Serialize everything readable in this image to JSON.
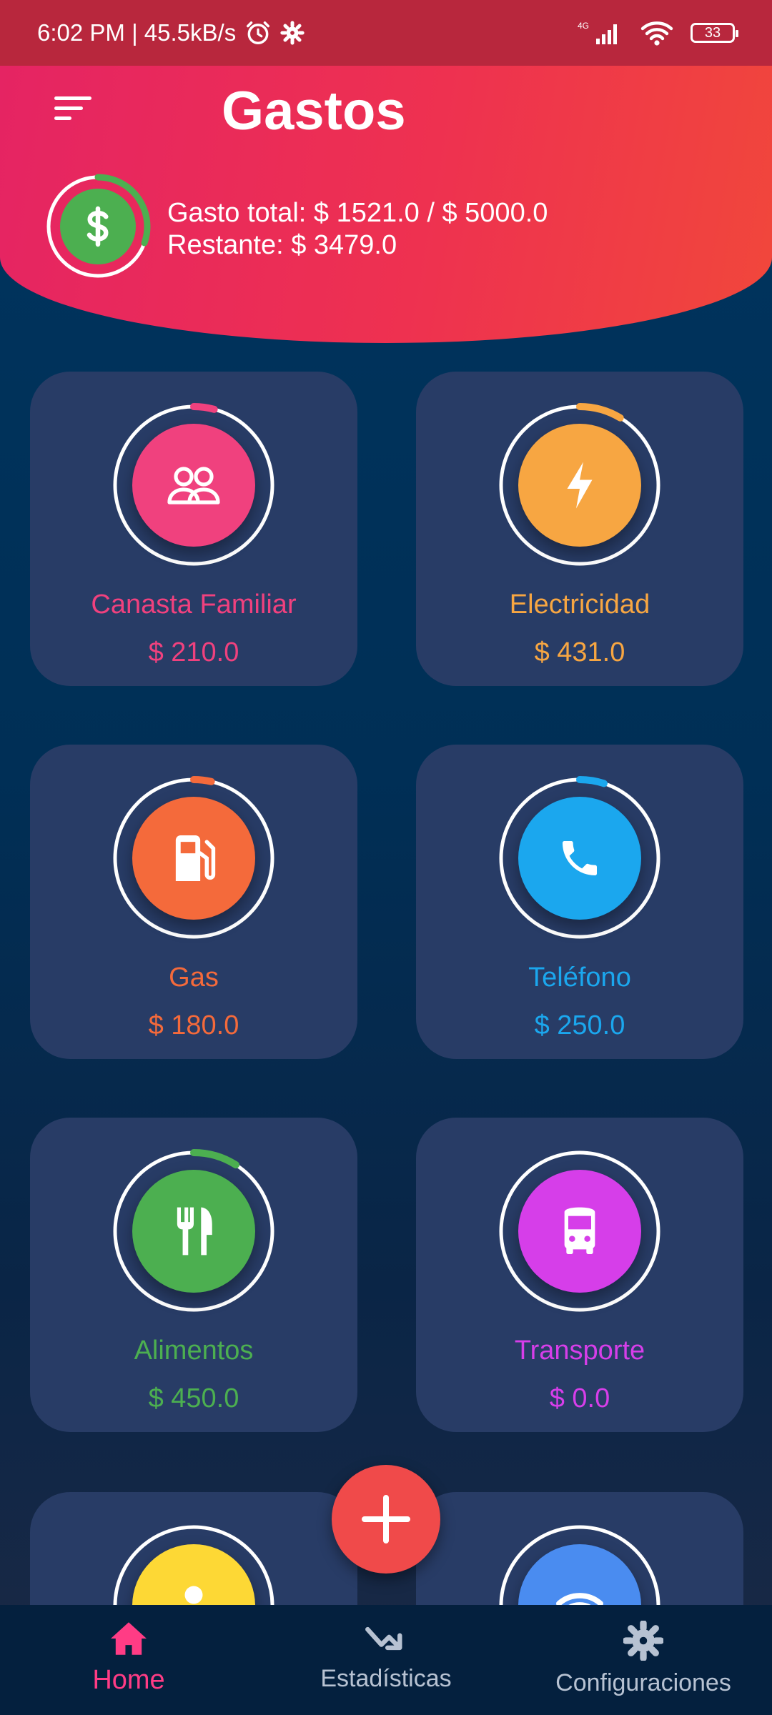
{
  "status_bar": {
    "time_speed": "6:02 PM | 45.5kB/s",
    "network": "4G",
    "battery": "33"
  },
  "header": {
    "title": "Gastos",
    "total_label": "Gasto total: $ 1521.0 / $ 5000.0",
    "remaining_label": "Restante: $ 3479.0",
    "spent_fraction": 0.304
  },
  "categories": [
    {
      "name": "Canasta Familiar",
      "amount": "$ 210.0",
      "color": "#f0417e",
      "icon": "people-icon"
    },
    {
      "name": "Electricidad",
      "amount": "$ 431.0",
      "color": "#f7a642",
      "icon": "lightning-icon"
    },
    {
      "name": "Gas",
      "amount": "$ 180.0",
      "color": "#f46a3b",
      "icon": "gas-pump-icon"
    },
    {
      "name": "Teléfono",
      "amount": "$ 250.0",
      "color": "#1ba7ee",
      "icon": "phone-icon"
    },
    {
      "name": "Alimentos",
      "amount": "$ 450.0",
      "color": "#4caf50",
      "icon": "utensils-icon"
    },
    {
      "name": "Transporte",
      "amount": "$ 0.0",
      "color": "#d63ee9",
      "icon": "bus-icon"
    }
  ],
  "partial_categories": [
    {
      "color": "#fdd835",
      "icon": "person-icon"
    },
    {
      "color": "#4a8cf0",
      "icon": "wifi-icon"
    }
  ],
  "colors": {
    "header_start": "#e52463",
    "header_end": "#f1473b",
    "background": "#00355f",
    "card": "#283c66",
    "fab": "#f04a4a",
    "nav_active": "#ff3c85"
  },
  "nav": {
    "home": "Home",
    "stats": "Estadísticas",
    "settings": "Configuraciones"
  }
}
